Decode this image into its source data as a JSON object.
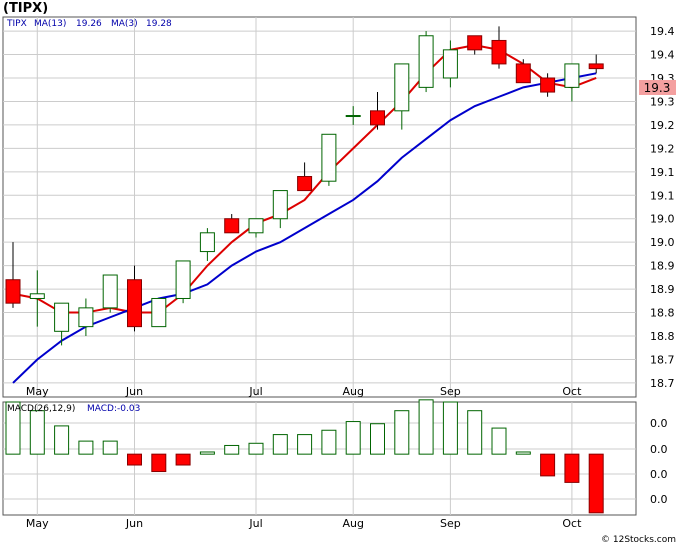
{
  "title": "(TIPX)",
  "legend": {
    "symbol": "TIPX",
    "ma13_label": "MA(13)",
    "ma13_value": "19.26",
    "ma3_label": "MA(3)",
    "ma3_value": "19.28"
  },
  "macd_legend": {
    "label": "MACD(26,12,9)",
    "value_label": "MACD:-0.03"
  },
  "last_price_label": "19.3",
  "watermark": "© 12Stocks.com",
  "colors": {
    "up_fill": "#ffffff",
    "up_stroke": "#006400",
    "down_fill": "#ff0000",
    "ma3": "#dd0000",
    "ma13": "#0000cc",
    "macd_up": "#006400",
    "price_box": "#f4a0a0"
  },
  "chart_data": [
    {
      "type": "candlestick",
      "title": "(TIPX)",
      "x_labels": [
        "May",
        "Jun",
        "Jul",
        "Aug",
        "Sep",
        "Oct"
      ],
      "x_label_candle_index": [
        1,
        5,
        10,
        14,
        18,
        23
      ],
      "y_tick_labels": [
        "19.4",
        "19.4",
        "19.3",
        "19.3",
        "19.2",
        "19.2",
        "19.1",
        "19.1",
        "19.0",
        "19.0",
        "18.9",
        "18.9",
        "18.8",
        "18.8",
        "18.7",
        "18.7"
      ],
      "y_tick_values": [
        19.4,
        19.35,
        19.3,
        19.25,
        19.2,
        19.15,
        19.1,
        19.05,
        19.0,
        18.95,
        18.9,
        18.85,
        18.8,
        18.75,
        18.7,
        18.65
      ],
      "ylim": [
        18.62,
        19.43
      ],
      "grid": true,
      "candles": [
        {
          "open": 18.87,
          "high": 18.95,
          "low": 18.81,
          "close": 18.82
        },
        {
          "open": 18.83,
          "high": 18.89,
          "low": 18.77,
          "close": 18.84
        },
        {
          "open": 18.76,
          "high": 18.82,
          "low": 18.73,
          "close": 18.82
        },
        {
          "open": 18.77,
          "high": 18.83,
          "low": 18.75,
          "close": 18.81
        },
        {
          "open": 18.81,
          "high": 18.88,
          "low": 18.8,
          "close": 18.88
        },
        {
          "open": 18.87,
          "high": 18.9,
          "low": 18.76,
          "close": 18.77
        },
        {
          "open": 18.77,
          "high": 18.83,
          "low": 18.77,
          "close": 18.83
        },
        {
          "open": 18.83,
          "high": 18.91,
          "low": 18.82,
          "close": 18.91
        },
        {
          "open": 18.93,
          "high": 18.98,
          "low": 18.91,
          "close": 18.97
        },
        {
          "open": 19.0,
          "high": 19.01,
          "low": 18.97,
          "close": 18.97
        },
        {
          "open": 18.97,
          "high": 19.0,
          "low": 18.96,
          "close": 19.0
        },
        {
          "open": 19.0,
          "high": 19.06,
          "low": 18.98,
          "close": 19.06
        },
        {
          "open": 19.09,
          "high": 19.12,
          "low": 19.07,
          "close": 19.06
        },
        {
          "open": 19.08,
          "high": 19.18,
          "low": 19.07,
          "close": 19.18
        },
        {
          "open": 19.22,
          "high": 19.24,
          "low": 19.2,
          "close": 19.22
        },
        {
          "open": 19.23,
          "high": 19.27,
          "low": 19.19,
          "close": 19.2
        },
        {
          "open": 19.23,
          "high": 19.33,
          "low": 19.19,
          "close": 19.33
        },
        {
          "open": 19.28,
          "high": 19.4,
          "low": 19.27,
          "close": 19.39
        },
        {
          "open": 19.3,
          "high": 19.38,
          "low": 19.28,
          "close": 19.36
        },
        {
          "open": 19.39,
          "high": 19.39,
          "low": 19.35,
          "close": 19.36
        },
        {
          "open": 19.38,
          "high": 19.41,
          "low": 19.32,
          "close": 19.33
        },
        {
          "open": 19.33,
          "high": 19.34,
          "low": 19.29,
          "close": 19.29
        },
        {
          "open": 19.3,
          "high": 19.31,
          "low": 19.26,
          "close": 19.27
        },
        {
          "open": 19.28,
          "high": 19.33,
          "low": 19.25,
          "close": 19.33
        },
        {
          "open": 19.33,
          "high": 19.35,
          "low": 19.31,
          "close": 19.32
        }
      ],
      "series": [
        {
          "name": "MA(3)",
          "values": [
            18.84,
            18.83,
            18.8,
            18.8,
            18.81,
            18.8,
            18.8,
            18.84,
            18.9,
            18.95,
            18.99,
            19.01,
            19.04,
            19.1,
            19.15,
            19.2,
            19.25,
            19.31,
            19.36,
            19.37,
            19.36,
            19.33,
            19.29,
            19.28,
            19.3
          ]
        },
        {
          "name": "MA(13)",
          "values": [
            18.65,
            18.7,
            18.74,
            18.77,
            18.79,
            18.81,
            18.83,
            18.84,
            18.86,
            18.9,
            18.93,
            18.95,
            18.98,
            19.01,
            19.04,
            19.08,
            19.13,
            19.17,
            19.21,
            19.24,
            19.26,
            19.28,
            19.29,
            19.3,
            19.31
          ]
        }
      ]
    },
    {
      "type": "bar",
      "title": "MACD(26,12,9)",
      "y_tick_labels": [
        "0.0",
        "0.0",
        "0.0",
        "0.0"
      ],
      "ylim": [
        -0.028,
        0.024
      ],
      "values": [
        0.024,
        0.02,
        0.013,
        0.006,
        0.006,
        -0.005,
        -0.008,
        -0.005,
        0.001,
        0.004,
        0.005,
        0.009,
        0.009,
        0.011,
        0.015,
        0.014,
        0.02,
        0.025,
        0.024,
        0.02,
        0.012,
        0.001,
        -0.01,
        -0.013,
        -0.027
      ]
    }
  ]
}
